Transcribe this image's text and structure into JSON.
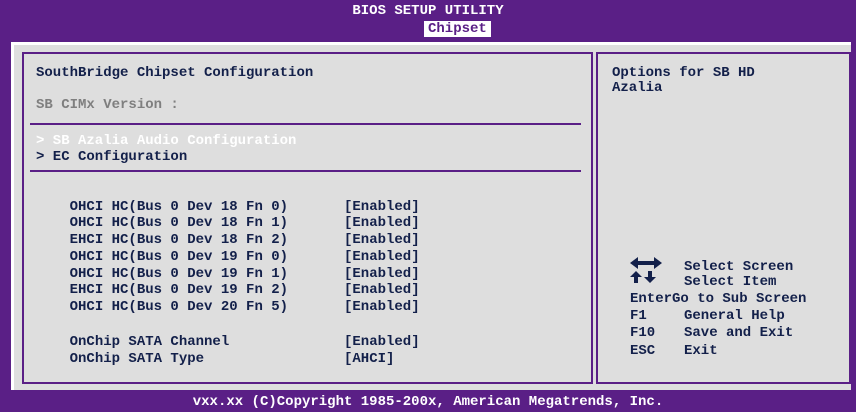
{
  "header": {
    "title": "BIOS SETUP UTILITY",
    "active_tab": "Chipset"
  },
  "main": {
    "section_title": "SouthBridge Chipset Configuration",
    "cimx_label": "SB CIMx Version :",
    "submenus": [
      {
        "label": "> SB Azalia Audio Configuration"
      },
      {
        "label": "> EC Configuration"
      }
    ],
    "controllers": [
      {
        "label": "OHCI HC(Bus 0 Dev 18 Fn 0)",
        "value": "[Enabled]"
      },
      {
        "label": "OHCI HC(Bus 0 Dev 18 Fn 1)",
        "value": "[Enabled]"
      },
      {
        "label": "EHCI HC(Bus 0 Dev 18 Fn 2)",
        "value": "[Enabled]"
      },
      {
        "label": "OHCI HC(Bus 0 Dev 19 Fn 0)",
        "value": "[Enabled]"
      },
      {
        "label": "OHCI HC(Bus 0 Dev 19 Fn 1)",
        "value": "[Enabled]"
      },
      {
        "label": "EHCI HC(Bus 0 Dev 19 Fn 2)",
        "value": "[Enabled]"
      },
      {
        "label": "OHCI HC(Bus 0 Dev 20 Fn 5)",
        "value": "[Enabled]"
      }
    ],
    "sata": [
      {
        "label": "OnChip SATA Channel",
        "value": "[Enabled]"
      },
      {
        "label": "OnChip SATA Type",
        "value": "[AHCI]"
      }
    ]
  },
  "help_panel": {
    "description_line1": "Options for SB HD",
    "description_line2": "Azalia",
    "keys": {
      "select_screen": "Select Screen",
      "select_item": "Select Item",
      "enter_key": "Enter",
      "enter_action": "Go to Sub Screen",
      "f1_key": "F1",
      "f1_action": "General Help",
      "f10_key": "F10",
      "f10_action": "Save and Exit",
      "esc_key": "ESC",
      "esc_action": "Exit"
    }
  },
  "footer": {
    "copyright": "vxx.xx (C)Copyright 1985-200x, American Megatrends, Inc."
  },
  "colors": {
    "background": "#5a1f86",
    "panel": "#dedede",
    "text": "#13204a",
    "muted": "#7f7f7f",
    "highlight": "#ffffff"
  },
  "icons": {
    "navigation": "arrow-keys-icon"
  }
}
